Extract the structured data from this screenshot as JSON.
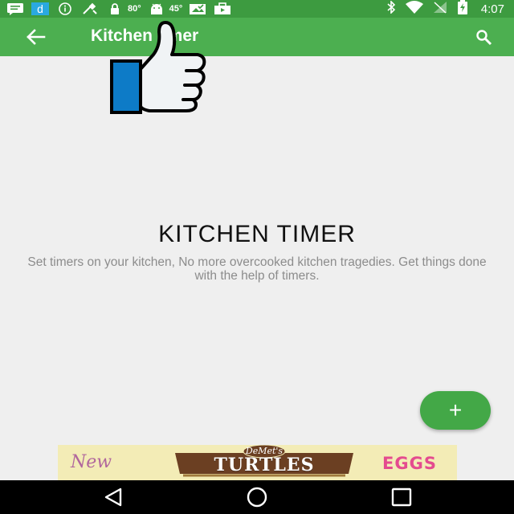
{
  "status_bar": {
    "temp_1": "80°",
    "temp_2": "45°",
    "time": "4:07"
  },
  "app_bar": {
    "title": "Kitchen timer",
    "back_icon": "arrow-back-icon",
    "search_icon": "search-icon"
  },
  "overlay": {
    "icon": "thumbs-up-icon"
  },
  "hero": {
    "title": "KITCHEN TIMER",
    "description": "Set timers on your kitchen, No more overcooked kitchen tragedies. Get things done with the help of timers."
  },
  "fab": {
    "label": "+",
    "icon": "add-icon"
  },
  "ad": {
    "new_text": "New",
    "brand_text": "DeMet's",
    "product_text": "TURTLES",
    "eggs_text": "EGGS"
  },
  "nav_bar": {
    "back_icon": "nav-back-icon",
    "home_icon": "nav-home-icon",
    "recents_icon": "nav-recents-icon"
  },
  "colors": {
    "status_bar": "#3d9b40",
    "app_bar": "#4caf50",
    "fab": "#43a847",
    "background": "#efefef"
  }
}
